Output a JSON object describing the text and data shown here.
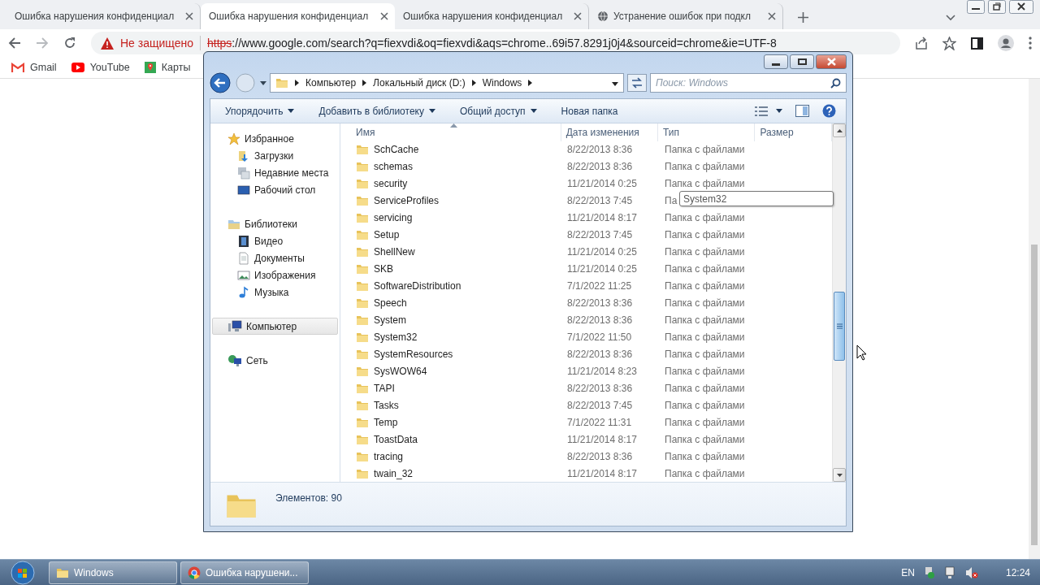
{
  "browser": {
    "tabs": [
      {
        "label": "Ошибка нарушения конфиденциал",
        "selected": false
      },
      {
        "label": "Ошибка нарушения конфиденциал",
        "selected": true
      },
      {
        "label": "Ошибка нарушения конфиденциал",
        "selected": false
      },
      {
        "label": "Устранение ошибок при подкл",
        "selected": false
      }
    ],
    "address": {
      "security": "Не защищено",
      "scheme": "https",
      "rest": "://www.google.com/search?q=fiexvdi&oq=fiexvdi&aqs=chrome..69i57.8291j0j4&sourceid=chrome&ie=UTF-8"
    },
    "bookmarks": [
      "Gmail",
      "YouTube",
      "Карты"
    ]
  },
  "explorer": {
    "breadcrumb": [
      "Компьютер",
      "Локальный диск (D:)",
      "Windows"
    ],
    "search": {
      "placeholder": "Поиск: Windows"
    },
    "commands": [
      {
        "label": "Упорядочить",
        "dropdown": true
      },
      {
        "label": "Добавить в библиотеку",
        "dropdown": true
      },
      {
        "label": "Общий доступ",
        "dropdown": true
      },
      {
        "label": "Новая папка",
        "dropdown": false
      }
    ],
    "nav": [
      {
        "label": "Избранное",
        "selected": false,
        "children": [
          {
            "label": "Загрузки",
            "selected": false
          },
          {
            "label": "Недавние места",
            "selected": false
          },
          {
            "label": "Рабочий стол",
            "selected": false
          }
        ]
      },
      {
        "label": "Библиотеки",
        "selected": false,
        "children": [
          {
            "label": "Видео",
            "selected": false
          },
          {
            "label": "Документы",
            "selected": false
          },
          {
            "label": "Изображения",
            "selected": false
          },
          {
            "label": "Музыка",
            "selected": false
          }
        ]
      },
      {
        "label": "Компьютер",
        "selected": true
      },
      {
        "label": "Сеть",
        "selected": false
      }
    ],
    "columns": [
      {
        "label": "Имя",
        "sorted": true
      },
      {
        "label": "Дата изменения",
        "sorted": false
      },
      {
        "label": "Тип",
        "sorted": false
      },
      {
        "label": "Размер",
        "sorted": false
      }
    ],
    "rows": [
      {
        "name": "SchCache",
        "date": "8/22/2013 8:36",
        "type": "Папка с файлами"
      },
      {
        "name": "schemas",
        "date": "8/22/2013 8:36",
        "type": "Папка с файлами"
      },
      {
        "name": "security",
        "date": "11/21/2014 0:25",
        "type": "Папка с файлами"
      },
      {
        "name": "ServiceProfiles",
        "date": "8/22/2013 7:45",
        "type": "Па"
      },
      {
        "name": "servicing",
        "date": "11/21/2014 8:17",
        "type": "Папка с файлами"
      },
      {
        "name": "Setup",
        "date": "8/22/2013 7:45",
        "type": "Папка с файлами"
      },
      {
        "name": "ShellNew",
        "date": "11/21/2014 0:25",
        "type": "Папка с файлами"
      },
      {
        "name": "SKB",
        "date": "11/21/2014 0:25",
        "type": "Папка с файлами"
      },
      {
        "name": "SoftwareDistribution",
        "date": "7/1/2022 11:25",
        "type": "Папка с файлами"
      },
      {
        "name": "Speech",
        "date": "8/22/2013 8:36",
        "type": "Папка с файлами"
      },
      {
        "name": "System",
        "date": "8/22/2013 8:36",
        "type": "Папка с файлами"
      },
      {
        "name": "System32",
        "date": "7/1/2022 11:50",
        "type": "Папка с файлами"
      },
      {
        "name": "SystemResources",
        "date": "8/22/2013 8:36",
        "type": "Папка с файлами"
      },
      {
        "name": "SysWOW64",
        "date": "11/21/2014 8:23",
        "type": "Папка с файлами"
      },
      {
        "name": "TAPI",
        "date": "8/22/2013 8:36",
        "type": "Папка с файлами"
      },
      {
        "name": "Tasks",
        "date": "8/22/2013 7:45",
        "type": "Папка с файлами"
      },
      {
        "name": "Temp",
        "date": "7/1/2022 11:31",
        "type": "Папка с файлами"
      },
      {
        "name": "ToastData",
        "date": "11/21/2014 8:17",
        "type": "Папка с файлами"
      },
      {
        "name": "tracing",
        "date": "8/22/2013 8:36",
        "type": "Папка с файлами"
      },
      {
        "name": "twain_32",
        "date": "11/21/2014 8:17",
        "type": "Папка с файлами"
      }
    ],
    "tooltip": "System32",
    "status": "Элементов: 90"
  },
  "taskbar": {
    "buttons": [
      "Windows",
      "Ошибка нарушени..."
    ],
    "language": "EN",
    "clock": "12:24"
  }
}
